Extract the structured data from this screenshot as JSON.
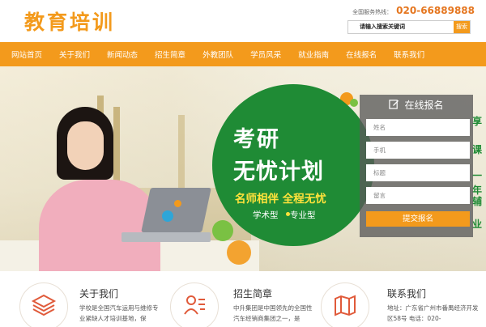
{
  "header": {
    "logo_text": "教育培训",
    "hotline_label": "全国服务热线：",
    "hotline_number": "020-66889888",
    "search_placeholder": "请输入搜索关键词",
    "search_button": "搜索"
  },
  "nav": {
    "items": [
      "网站首页",
      "关于我们",
      "新闻动态",
      "招生简章",
      "外教团队",
      "学员风采",
      "就业指南",
      "在线报名",
      "联系我们"
    ]
  },
  "hero": {
    "title_line1": "考研",
    "title_line2": "无忧计划",
    "slogan": "名师相伴 全程无忧",
    "type_a": "学术型",
    "type_b": "专业型",
    "edge_text": [
      "享",
      "课",
      "一",
      "年",
      "辅",
      "业"
    ]
  },
  "form": {
    "title": "在线报名",
    "fields": [
      "姓名",
      "手机",
      "标题",
      "留言"
    ],
    "submit": "提交报名"
  },
  "features": [
    {
      "title": "关于我们",
      "desc": "学校是全国汽车运用与维修专业紧缺人才培训基地，保"
    },
    {
      "title": "招生简章",
      "desc": "中升集团是中国领先的全国性汽车经销商集团之一，是"
    },
    {
      "title": "联系我们",
      "desc": "地址：广东省广州市番禺经济开发区58号 电话：020-"
    }
  ],
  "colors": {
    "accent": "#f39a1c",
    "brand_green": "#1f8b35",
    "nav_text": "#ffffff"
  },
  "icons": [
    "edit-icon",
    "layers-icon",
    "resume-icon",
    "map-icon"
  ]
}
